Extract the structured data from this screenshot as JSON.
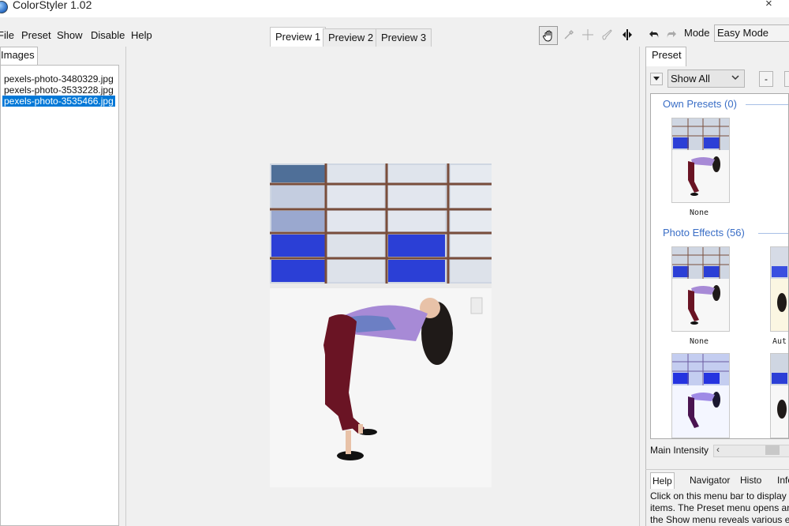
{
  "window": {
    "title": "ColorStyler 1.02",
    "close_glyph": "×"
  },
  "menu": {
    "items": [
      "File",
      "Preset",
      "Show",
      "Disable",
      "Help"
    ]
  },
  "preview_tabs": [
    "Preview 1",
    "Preview 2",
    "Preview 3"
  ],
  "toolbar": {
    "icons": [
      "hand-icon",
      "eyedropper-icon",
      "crosshair-icon",
      "brush-icon",
      "split-compare-icon",
      "undo-icon",
      "redo-icon"
    ],
    "mode_label": "Mode",
    "mode_value": "Easy Mode"
  },
  "left_panel": {
    "tab_label": "Images",
    "files": [
      "pexels-photo-3480329.jpg",
      "pexels-photo-3533228.jpg",
      "pexels-photo-3535466.jpg"
    ],
    "selected_index": 2
  },
  "right_panel": {
    "tab_label": "Preset",
    "filter_value": "Show All",
    "minus_label": "-",
    "own_presets": {
      "label": "Own Presets (0)",
      "items": [
        "None"
      ]
    },
    "photo_effects": {
      "label": "Photo Effects (56)",
      "items": [
        "None",
        "Aut"
      ]
    },
    "intensity_label": "Main Intensity",
    "bottom_tabs": [
      "Help",
      "Navigator",
      "Histo",
      "Info"
    ],
    "help_text": [
      "Click on this menu bar to display d",
      "items. The Preset menu opens an",
      "the Show menu reveals various e"
    ]
  },
  "colors": {
    "selection": "#0078d7",
    "group_header": "#3a6ec6",
    "photo_blue": "#2b3fd6"
  }
}
